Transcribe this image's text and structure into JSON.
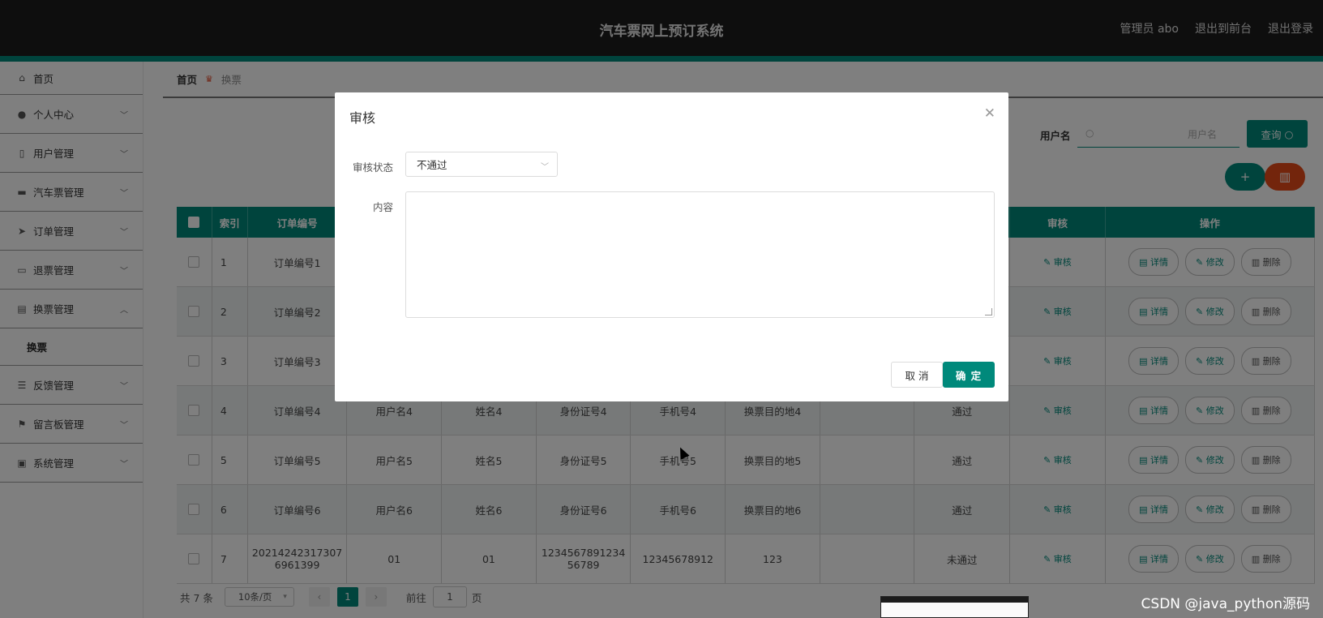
{
  "header": {
    "app_title": "汽车票网上预订系统",
    "admin_label": "管理员 abo",
    "to_front": "退出到前台",
    "logout": "退出登录"
  },
  "sidebar": {
    "items": [
      {
        "label": "首页",
        "icon": "home-icon"
      },
      {
        "label": "个人中心",
        "icon": "user-icon"
      },
      {
        "label": "用户管理",
        "icon": "users-icon"
      },
      {
        "label": "汽车票管理",
        "icon": "ticket-icon"
      },
      {
        "label": "订单管理",
        "icon": "send-icon"
      },
      {
        "label": "退票管理",
        "icon": "monitor-icon"
      },
      {
        "label": "换票管理",
        "icon": "clipboard-icon"
      },
      {
        "label": "反馈管理",
        "icon": "sliders-icon"
      },
      {
        "label": "留言板管理",
        "icon": "flag-icon"
      },
      {
        "label": "系统管理",
        "icon": "briefcase-icon"
      }
    ],
    "sub_item": "换票"
  },
  "breadcrumb": {
    "home": "首页",
    "current": "换票"
  },
  "search": {
    "label": "用户名",
    "placeholder": "用户名",
    "button": "查询"
  },
  "actions": {
    "add": "+",
    "delete": "🗑"
  },
  "table": {
    "headers": [
      "索引",
      "订单编号",
      "",
      "",
      "",
      "",
      "",
      "",
      "",
      "审核",
      "操作"
    ],
    "rows": [
      {
        "idx": "1",
        "order": "订单编号1",
        "user": "",
        "name": "",
        "idcard": "",
        "phone": "",
        "dest": "",
        "status": ""
      },
      {
        "idx": "2",
        "order": "订单编号2",
        "user": "",
        "name": "",
        "idcard": "",
        "phone": "",
        "dest": "",
        "status": ""
      },
      {
        "idx": "3",
        "order": "订单编号3",
        "user": "",
        "name": "",
        "idcard": "",
        "phone": "",
        "dest": "",
        "status": ""
      },
      {
        "idx": "4",
        "order": "订单编号4",
        "user": "用户名4",
        "name": "姓名4",
        "idcard": "身份证号4",
        "phone": "手机号4",
        "dest": "换票目的地4",
        "status": "通过"
      },
      {
        "idx": "5",
        "order": "订单编号5",
        "user": "用户名5",
        "name": "姓名5",
        "idcard": "身份证号5",
        "phone": "手机号5",
        "dest": "换票目的地5",
        "status": "通过"
      },
      {
        "idx": "6",
        "order": "订单编号6",
        "user": "用户名6",
        "name": "姓名6",
        "idcard": "身份证号6",
        "phone": "手机号6",
        "dest": "换票目的地6",
        "status": "通过"
      },
      {
        "idx": "7",
        "order": "20214242317307 6961399",
        "user": "01",
        "name": "01",
        "idcard": "1234567891234 56789",
        "phone": "12345678912",
        "dest": "123",
        "status": "未通过"
      }
    ],
    "audit_label": "审核",
    "op_detail": "详情",
    "op_edit": "修改",
    "op_delete": "删除"
  },
  "pagination": {
    "total": "共 7 条",
    "page_size": "10条/页",
    "current_page": "1",
    "goto_label": "前往",
    "goto_value": "1",
    "page_suffix": "页"
  },
  "dialog": {
    "title": "审核",
    "status_label": "审核状态",
    "status_value": "不通过",
    "content_label": "内容",
    "cancel": "取 消",
    "confirm": "确 定"
  },
  "watermark": "CSDN @java_python源码",
  "colors": {
    "accent": "#00897b",
    "danger": "#e64a19",
    "header_bg": "#1c1c1c"
  }
}
